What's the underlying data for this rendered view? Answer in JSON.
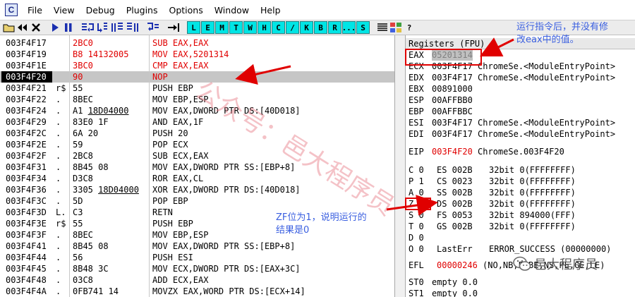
{
  "app_icon": "C",
  "menu": [
    "File",
    "View",
    "Debug",
    "Plugins",
    "Options",
    "Window",
    "Help"
  ],
  "toolbar": {
    "icons": [
      "open-icon",
      "rewind-icon",
      "close-icon",
      "run-icon",
      "pause-icon",
      "step-into-icon",
      "step-over-icon",
      "trace-into-icon",
      "trace-over-icon",
      "execute-till-return-icon",
      "goto-icon"
    ],
    "letters": [
      "L",
      "E",
      "M",
      "T",
      "W",
      "H",
      "C",
      "/",
      "K",
      "B",
      "R",
      "...",
      "S"
    ]
  },
  "disasm": {
    "rows": [
      {
        "addr": "003F4F17",
        "flow": "",
        "hex": "2BC0",
        "asm": "SUB EAX,EAX",
        "modified": true
      },
      {
        "addr": "003F4F19",
        "flow": "",
        "hex": "B8 14132005",
        "asm": "MOV EAX,5201314",
        "modified": true
      },
      {
        "addr": "003F4F1E",
        "flow": "",
        "hex": "3BC0",
        "asm": "CMP EAX,EAX",
        "modified": true
      },
      {
        "addr": "003F4F20",
        "flow": "",
        "hex": "90",
        "asm": "NOP",
        "modified": true
      },
      {
        "addr": "003F4F21",
        "flow": "r$",
        "hex": "55",
        "asm": "PUSH EBP"
      },
      {
        "addr": "003F4F22",
        "flow": ".",
        "hex": "8BEC",
        "asm": "MOV EBP,ESP"
      },
      {
        "addr": "003F4F24",
        "flow": ".",
        "hex": "A1 18D04000",
        "asm": "MOV EAX,DWORD PTR DS:[40D018]"
      },
      {
        "addr": "003F4F29",
        "flow": ".",
        "hex": "83E0 1F",
        "asm": "AND EAX,1F"
      },
      {
        "addr": "003F4F2C",
        "flow": ".",
        "hex": "6A 20",
        "asm": "PUSH 20"
      },
      {
        "addr": "003F4F2E",
        "flow": ".",
        "hex": "59",
        "asm": "POP ECX"
      },
      {
        "addr": "003F4F2F",
        "flow": ".",
        "hex": "2BC8",
        "asm": "SUB ECX,EAX"
      },
      {
        "addr": "003F4F31",
        "flow": ".",
        "hex": "8B45 08",
        "asm": "MOV EAX,DWORD PTR SS:[EBP+8]"
      },
      {
        "addr": "003F4F34",
        "flow": ".",
        "hex": "D3C8",
        "asm": "ROR EAX,CL"
      },
      {
        "addr": "003F4F36",
        "flow": ".",
        "hex": "3305 18D04000",
        "asm": "XOR EAX,DWORD PTR DS:[40D018]"
      },
      {
        "addr": "003F4F3C",
        "flow": ".",
        "hex": "5D",
        "asm": "POP EBP"
      },
      {
        "addr": "003F4F3D",
        "flow": "L.",
        "hex": "C3",
        "asm": "RETN"
      },
      {
        "addr": "003F4F3E",
        "flow": "r$",
        "hex": "55",
        "asm": "PUSH EBP"
      },
      {
        "addr": "003F4F3F",
        "flow": ".",
        "hex": "8BEC",
        "asm": "MOV EBP,ESP"
      },
      {
        "addr": "003F4F41",
        "flow": ".",
        "hex": "8B45 08",
        "asm": "MOV EAX,DWORD PTR SS:[EBP+8]"
      },
      {
        "addr": "003F4F44",
        "flow": ".",
        "hex": "56",
        "asm": "PUSH ESI"
      },
      {
        "addr": "003F4F45",
        "flow": ".",
        "hex": "8B48 3C",
        "asm": "MOV ECX,DWORD PTR DS:[EAX+3C]"
      },
      {
        "addr": "003F4F48",
        "flow": ".",
        "hex": "03C8",
        "asm": "ADD ECX,EAX"
      },
      {
        "addr": "003F4F4A",
        "flow": ".",
        "hex": "0FB741 14",
        "asm": "MOVZX EAX,WORD PTR DS:[ECX+14]"
      }
    ]
  },
  "registers": {
    "header": "Registers (FPU)",
    "gp": [
      {
        "name": "EAX",
        "value": "05201314",
        "comment": ""
      },
      {
        "name": "ECX",
        "value": "003F4F17",
        "comment": "ChromeSe.<ModuleEntryPoint>"
      },
      {
        "name": "EDX",
        "value": "003F4F17",
        "comment": "ChromeSe.<ModuleEntryPoint>"
      },
      {
        "name": "EBX",
        "value": "00891000",
        "comment": ""
      },
      {
        "name": "ESP",
        "value": "00AFFBB0",
        "comment": ""
      },
      {
        "name": "EBP",
        "value": "00AFFBBC",
        "comment": ""
      },
      {
        "name": "ESI",
        "value": "003F4F17",
        "comment": "ChromeSe.<ModuleEntryPoint>"
      },
      {
        "name": "EDI",
        "value": "003F4F17",
        "comment": "ChromeSe.<ModuleEntryPoint>"
      }
    ],
    "eip": {
      "name": "EIP",
      "value": "003F4F20",
      "comment": "ChromeSe.003F4F20"
    },
    "flags": [
      {
        "flag": "C 0",
        "seg": "ES 002B",
        "bits": "32bit 0(FFFFFFFF)"
      },
      {
        "flag": "P 1",
        "seg": "CS 0023",
        "bits": "32bit 0(FFFFFFFF)"
      },
      {
        "flag": "A 0",
        "seg": "SS 002B",
        "bits": "32bit 0(FFFFFFFF)"
      },
      {
        "flag": "Z 1",
        "seg": "DS 002B",
        "bits": "32bit 0(FFFFFFFF)"
      },
      {
        "flag": "S 0",
        "seg": "FS 0053",
        "bits": "32bit 894000(FFF)"
      },
      {
        "flag": "T 0",
        "seg": "GS 002B",
        "bits": "32bit 0(FFFFFFFF)"
      },
      {
        "flag": "D 0",
        "seg": "",
        "bits": ""
      },
      {
        "flag": "O 0",
        "seg": "LastErr",
        "bits": "ERROR_SUCCESS (00000000)"
      }
    ],
    "efl": {
      "name": "EFL",
      "value": "00000246",
      "comment": "(NO,NB,E,BE,NS,PE,GE,LE)"
    },
    "st": [
      {
        "name": "ST0",
        "value": "empty 0.0"
      },
      {
        "name": "ST1",
        "value": "empty 0.0"
      }
    ]
  },
  "annotations": {
    "eax_note_line1": "运行指令后，并没有修",
    "eax_note_line2": "改eax中的值。",
    "zf_note_line1": "ZF位为1，说明运行的",
    "zf_note_line2": "结果是0"
  },
  "watermark": "公众号：邑大程序员",
  "badge": "邑大程序员",
  "colors": {
    "modified_code": "#e00000",
    "annotation": "#3a5fe0",
    "highlight_box": "#e00000",
    "toolbar_letters": "#00e5e5"
  }
}
